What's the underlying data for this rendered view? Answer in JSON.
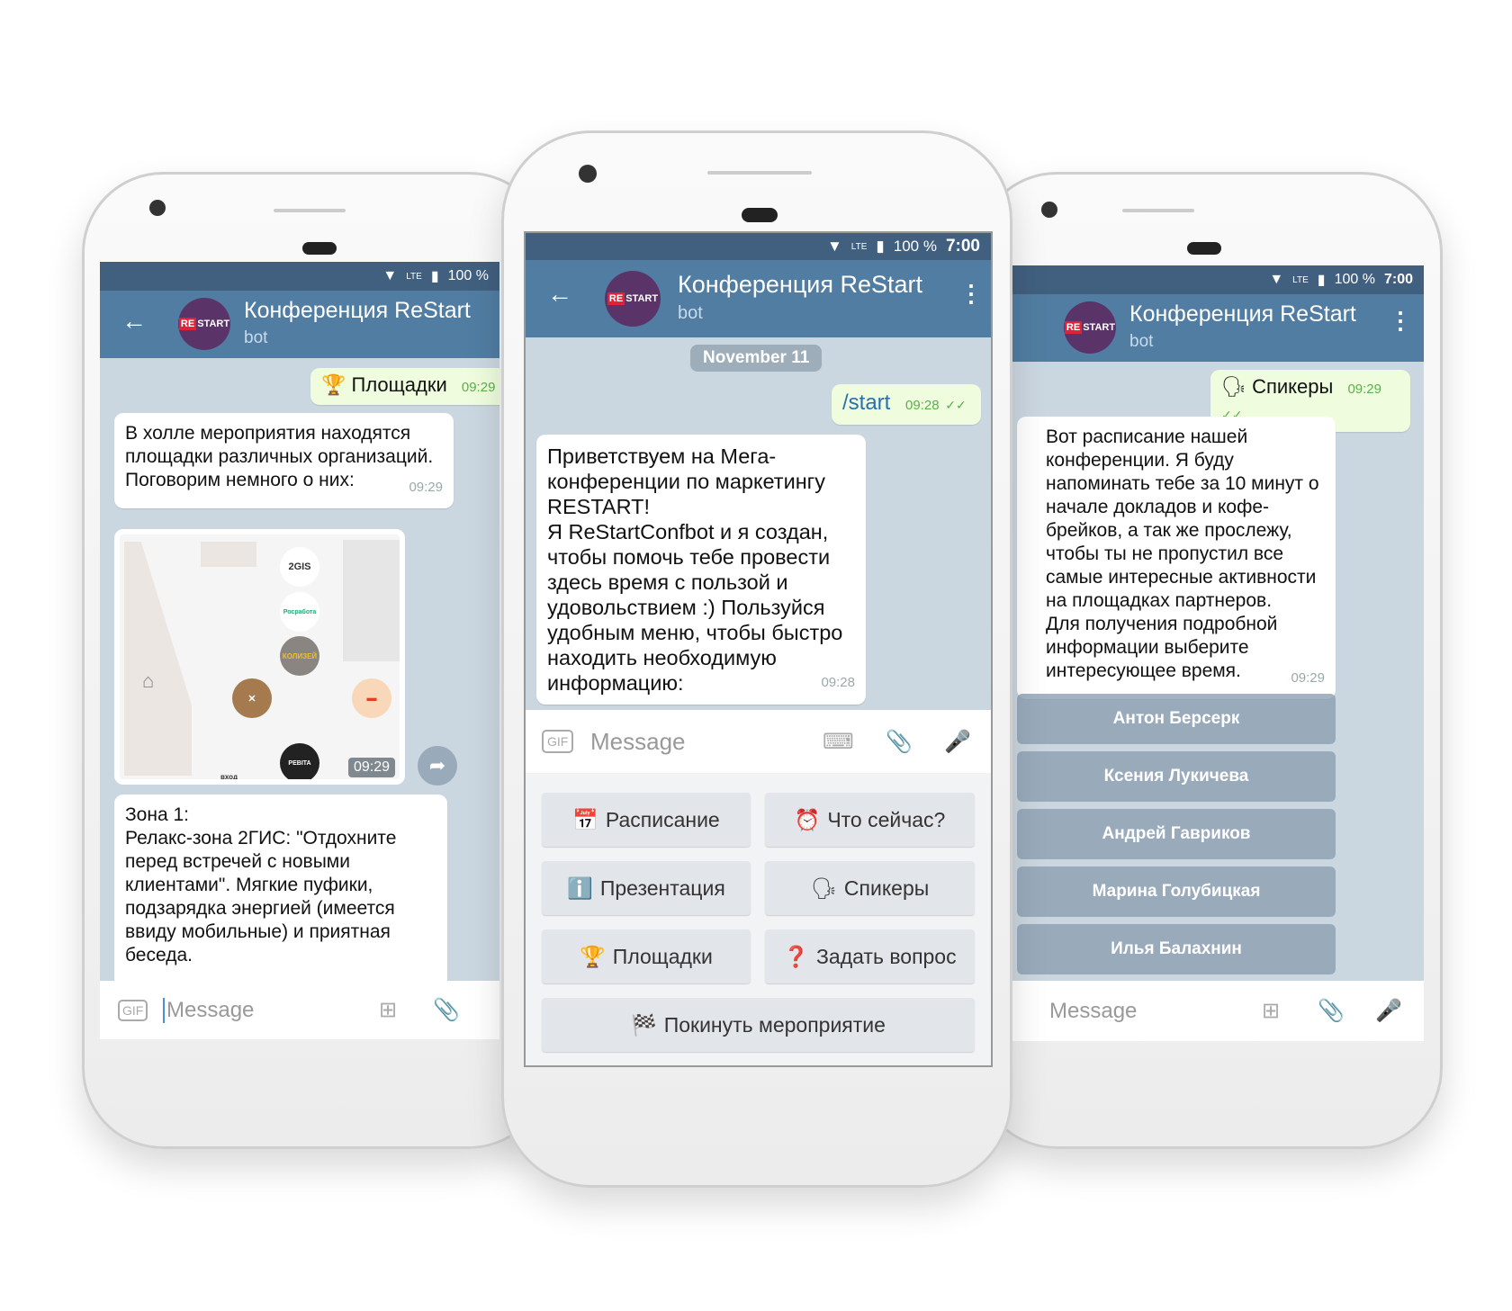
{
  "chat": {
    "title": "Конференция ReStart",
    "subtitle": "bot",
    "avatar_text_a": "RE",
    "avatar_text_b": "START",
    "battery": "100 %",
    "clock": "7:00",
    "network": "LTE",
    "input_placeholder": "Message",
    "gif_label": "GIF"
  },
  "left": {
    "sent": {
      "emoji": "🏆",
      "text": "Площадки",
      "time": "09:29"
    },
    "msg1": {
      "text": "В холле мероприятия находятся площадки различных организаций. Поговорим немного о них:",
      "time": "09:29"
    },
    "map": {
      "time": "09:29",
      "entrance": "вход",
      "logo_2gis": "2GIS",
      "logo_koliseum": "КОЛИЗЕЙ",
      "logo_rosrabota": "Росработа",
      "logo_pebita": "PEBITA"
    },
    "msg2": {
      "text": "Зона 1:\nРелакс-зона 2ГИС: \"Отдохните перед встречей с новыми клиентами\". Мягкие пуфики, подзарядка энергией (имеется ввиду мобильные) и приятная беседа."
    }
  },
  "center": {
    "date": "November 11",
    "sent": {
      "text": "/start",
      "time": "09:28"
    },
    "msg": {
      "text": "Приветствуем на Мега-конференции по маркетингу RESTART!\nЯ ReStartConfbot и я создан, чтобы помочь тебе провести здесь время с пользой и удовольствием :) Пользуйся удобным меню, чтобы быстро находить необходимую информацию:",
      "time": "09:28"
    },
    "buttons": [
      {
        "emoji": "📅",
        "label": "Расписание"
      },
      {
        "emoji": "⏰",
        "label": "Что сейчас?"
      },
      {
        "emoji": "ℹ️",
        "label": "Презентация"
      },
      {
        "emoji": "🗣",
        "label": "Спикеры"
      },
      {
        "emoji": "🏆",
        "label": "Площадки"
      },
      {
        "emoji": "❓",
        "label": "Задать вопрос"
      },
      {
        "emoji": "🏁",
        "label": "Покинуть мероприятие"
      }
    ]
  },
  "right": {
    "sent": {
      "emoji": "🗣",
      "text": "Спикеры",
      "time": "09:29"
    },
    "msg": {
      "text": "Вот расписание нашей конференции. Я буду напоминать тебе за 10 минут о начале докладов и кофе-брейков, а так же прослежу, чтобы ты не пропустил все самые интересные активности на площадках партнеров.\nДля получения подробной информации выберите интересующее время.",
      "time": "09:29"
    },
    "speakers": [
      "Антон Берсерк",
      "Ксения Лукичева",
      "Андрей Гавриков",
      "Марина Голубицкая",
      "Илья Балахнин"
    ]
  },
  "colors": {
    "status_bar": "#41607f",
    "header": "#517da2",
    "chat_bg": "#cbd7e0",
    "outgoing": "#effdde",
    "avatar": "#5a3468"
  }
}
